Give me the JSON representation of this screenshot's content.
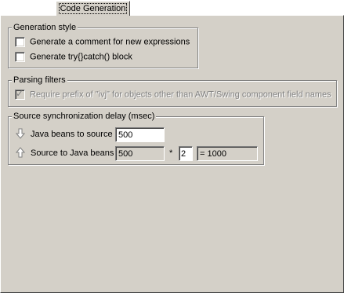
{
  "tab": {
    "label": "Code Generation"
  },
  "generation_style": {
    "title": "Generation style",
    "items": [
      {
        "label": "Generate a comment for new expressions",
        "checked": false
      },
      {
        "label": "Generate try{}catch() block",
        "checked": false
      }
    ]
  },
  "parsing_filters": {
    "title": "Parsing filters",
    "items": [
      {
        "label": "Require prefix of \"ivj\" for objects other than AWT/Swing component field names",
        "checked": true,
        "enabled": false
      }
    ]
  },
  "sync_delay": {
    "title": "Source synchronization delay (msec)",
    "beans_to_source": {
      "label": "Java beans to source",
      "value": "500",
      "icon": "down-arrow-icon"
    },
    "source_to_beans": {
      "label": "Source to Java beans",
      "value": "500",
      "operator": "*",
      "multiplier": "2",
      "result": "= 1000",
      "icon": "up-arrow-icon"
    }
  }
}
